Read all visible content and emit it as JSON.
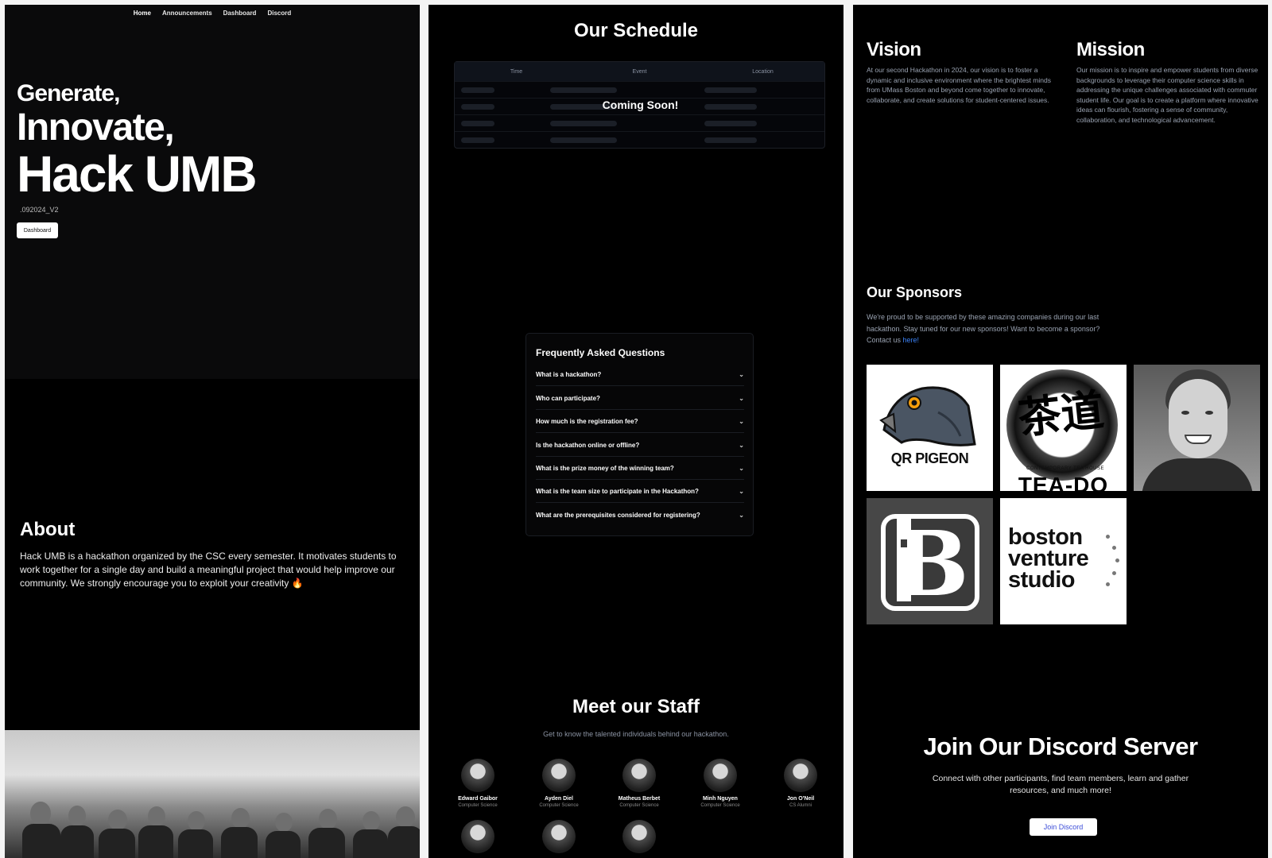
{
  "nav": {
    "items": [
      "Home",
      "Announcements",
      "Dashboard",
      "Discord"
    ]
  },
  "hero": {
    "line1": "Generate,",
    "line2": "Innovate,",
    "line3": "Hack UMB",
    "version": ".092024_V2",
    "dashboard_button": "Dashboard"
  },
  "about": {
    "title": "About",
    "text": "Hack UMB is a hackathon organized by the CSC every semester. It motivates students to work together for a single day and build a meaningful project that would help improve our community. We strongly encourage you to exploit your creativity 🔥"
  },
  "schedule": {
    "title": "Our Schedule",
    "columns": [
      "Time",
      "Event",
      "Location"
    ],
    "overlay": "Coming Soon!"
  },
  "faq": {
    "title": "Frequently Asked Questions",
    "items": [
      "What is a hackathon?",
      "Who can participate?",
      "How much is the registration fee?",
      "Is the hackathon online or offline?",
      "What is the prize money of the winning team?",
      "What is the team size to participate in the Hackathon?",
      "What are the prerequisites considered for registering?"
    ]
  },
  "staff": {
    "title": "Meet our Staff",
    "subtitle": "Get to know the talented individuals behind our hackathon.",
    "members": [
      {
        "name": "Edward Gaibor",
        "role": "Computer Science"
      },
      {
        "name": "Ayden Diel",
        "role": "Computer Science"
      },
      {
        "name": "Matheus Berbet",
        "role": "Computer Science"
      },
      {
        "name": "Minh Nguyen",
        "role": "Computer Science"
      },
      {
        "name": "Jon O'Neil",
        "role": "CS Alumni"
      }
    ]
  },
  "vision": {
    "title": "Vision",
    "text": "At our second Hackathon in 2024, our vision is to foster a dynamic and inclusive environment where the brightest minds from UMass Boston and beyond come together to innovate, collaborate, and create solutions for student-centered issues."
  },
  "mission": {
    "title": "Mission",
    "text": "Our mission is to inspire and empower students from diverse backgrounds to leverage their computer science skills in addressing the unique challenges associated with commuter student life. Our goal is to create a platform where innovative ideas can flourish, fostering a sense of community, collaboration, and technological advancement."
  },
  "sponsors": {
    "title": "Our Sponsors",
    "text": "We're proud to be supported by these amazing companies during our last hackathon. Stay tuned for our new sponsors! Want to become a sponsor? Contact us",
    "link": "here!",
    "logos": {
      "qr_pigeon": "QR PIGEON",
      "teado_small": "CONTEMPORARY TEA HOUSE",
      "teado_big": "TEA-DO",
      "bvs": [
        "boston",
        "venture",
        "studio"
      ]
    }
  },
  "discord": {
    "title": "Join Our Discord Server",
    "text": "Connect with other participants, find team members, learn and gather resources, and much more!",
    "button": "Join Discord"
  },
  "colors": {
    "accent_blue": "#3b82f6",
    "pigeon_eye": "#f59e0b"
  }
}
